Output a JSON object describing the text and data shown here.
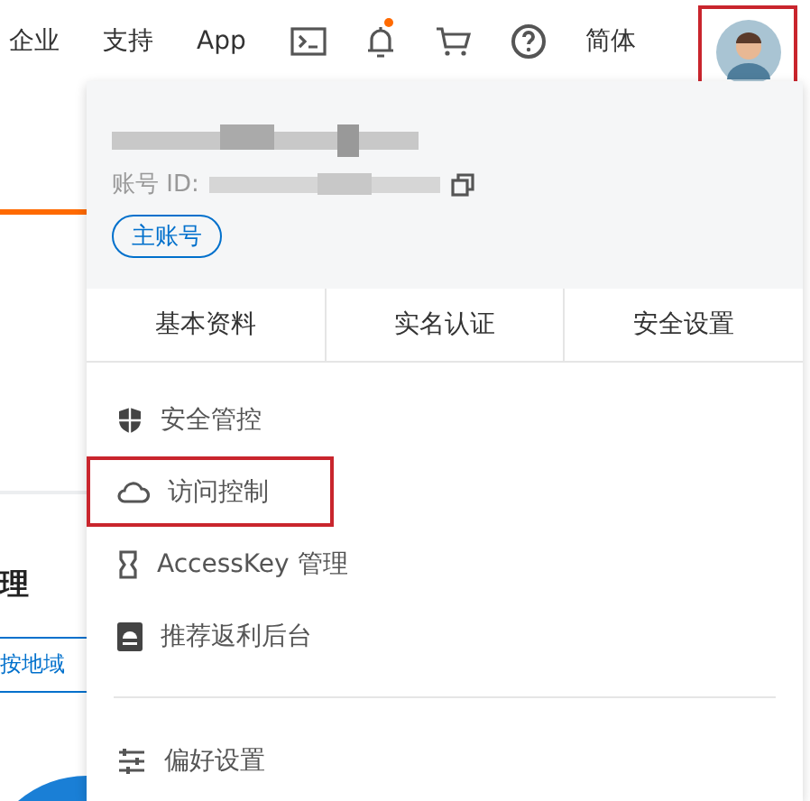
{
  "top_nav": [
    {
      "kind": "text",
      "label": "企业"
    },
    {
      "kind": "text",
      "label": "支持"
    },
    {
      "kind": "text",
      "label": "App"
    },
    {
      "kind": "terminal"
    },
    {
      "kind": "bell",
      "badge": true
    },
    {
      "kind": "cart"
    },
    {
      "kind": "help"
    },
    {
      "kind": "text",
      "label": "简体"
    },
    {
      "kind": "avatar",
      "highlighted": true
    }
  ],
  "background": {
    "heading": "理",
    "filter_tab": "按地域"
  },
  "account": {
    "id_label": "账号 ID:",
    "badge": "主账号"
  },
  "tabs": [
    {
      "label": "基本资料"
    },
    {
      "label": "实名认证"
    },
    {
      "label": "安全设置"
    }
  ],
  "menu": [
    {
      "label": "安全管控",
      "highlighted": false
    },
    {
      "label": "访问控制",
      "highlighted": true
    },
    {
      "label": "AccessKey 管理",
      "highlighted": false
    },
    {
      "label": "推荐返利后台",
      "highlighted": false
    }
  ],
  "footer_menu": [
    {
      "label": "偏好设置",
      "highlighted": false
    }
  ]
}
